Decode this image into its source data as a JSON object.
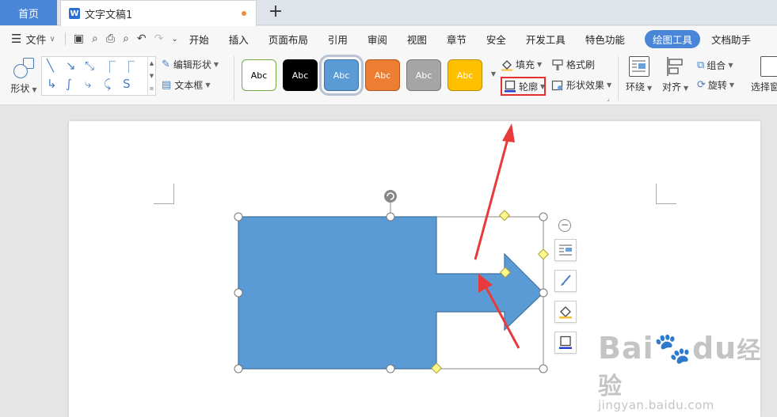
{
  "tabs": {
    "home": "首页",
    "doc_name": "文字文稿1",
    "add": "+"
  },
  "menu": {
    "file": "文件",
    "items": [
      "开始",
      "插入",
      "页面布局",
      "引用",
      "审阅",
      "视图",
      "章节",
      "安全",
      "开发工具",
      "特色功能"
    ],
    "active": "绘图工具",
    "overflow": "文档助手"
  },
  "ribbon": {
    "shape": "形状",
    "edit_shape": "编辑形状",
    "text_box": "文本框",
    "style_text": "Abc",
    "styles": [
      {
        "bg": "#ffffff",
        "border": "#70ad47",
        "fg": "#000000"
      },
      {
        "bg": "#000000",
        "border": "#000000",
        "fg": "#ffffff"
      },
      {
        "bg": "#5b9bd5",
        "border": "#41719c",
        "fg": "#ffffff"
      },
      {
        "bg": "#ed7d31",
        "border": "#ae5a21",
        "fg": "#ffffff"
      },
      {
        "bg": "#a5a5a5",
        "border": "#787878",
        "fg": "#ffffff"
      },
      {
        "bg": "#ffc000",
        "border": "#bc8c00",
        "fg": "#ffffff"
      }
    ],
    "fill": "填充",
    "outline": "轮廓",
    "format_painter": "格式刷",
    "shape_effect": "形状效果",
    "wrap": "环绕",
    "align": "对齐",
    "group": "组合",
    "rotate": "旋转",
    "selection_pane": "选择窗"
  },
  "watermark": {
    "brand": "Bai",
    "brand2": "du",
    "cn": "经验",
    "url": "jingyan.baidu.com"
  },
  "colors": {
    "accent": "#4a86d8",
    "shape_fill": "#5b9bd5",
    "highlight_box": "#e03030",
    "arrow_annotation": "#e83a3a"
  }
}
